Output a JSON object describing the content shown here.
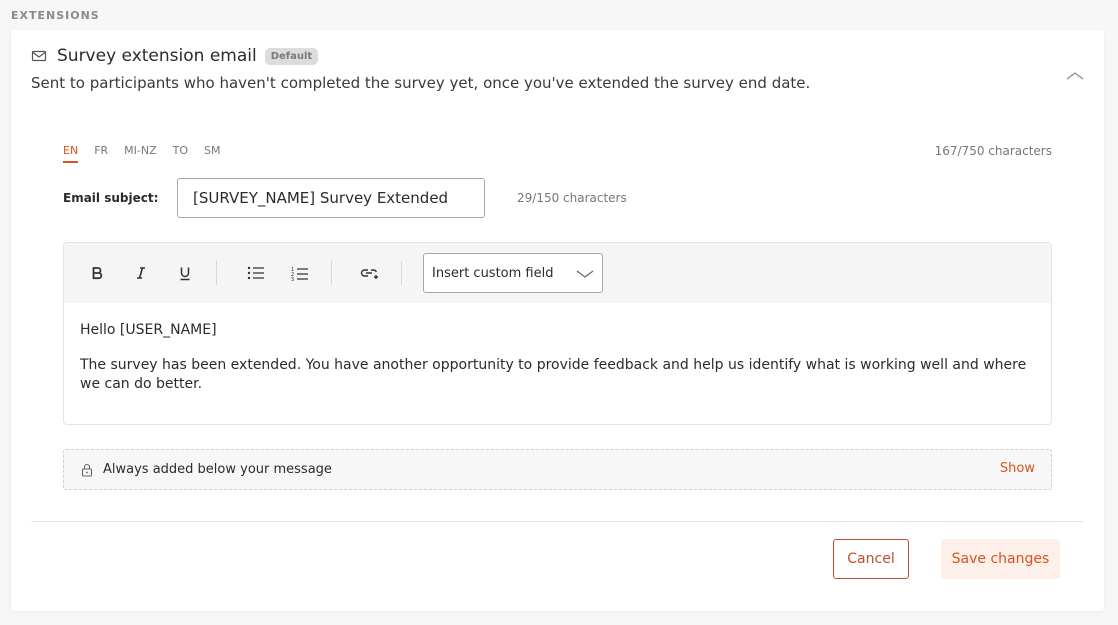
{
  "section": {
    "label": "EXTENSIONS"
  },
  "card": {
    "title": "Survey extension email",
    "badge": "Default",
    "description": "Sent to participants who haven't completed the survey yet, once you've extended the survey end date."
  },
  "languages": {
    "tabs": [
      "EN",
      "FR",
      "MI-NZ",
      "TO",
      "SM"
    ],
    "active": "EN"
  },
  "counts": {
    "total": "167/750 characters",
    "subject": "29/150 characters"
  },
  "subject": {
    "label": "Email subject:",
    "value": "[SURVEY_NAME] Survey Extended"
  },
  "toolbar": {
    "buttons": [
      "bold-icon",
      "italic-icon",
      "underline-icon",
      "bulleted-list-icon",
      "numbered-list-icon",
      "add-link-icon"
    ],
    "custom_field_placeholder": "Insert custom field"
  },
  "body": {
    "greeting": "Hello [USER_NAME]",
    "paragraph": "The survey has been extended. You have another opportunity to provide feedback and help us identify what is working well and where we can do better."
  },
  "footer_note": {
    "text": "Always added below your message",
    "show_label": "Show"
  },
  "actions": {
    "cancel_label": "Cancel",
    "save_label": "Save changes"
  },
  "colors": {
    "accent": "#d9531e",
    "badge_bg": "#dcdcdc",
    "save_bg": "#fdf0ea"
  }
}
